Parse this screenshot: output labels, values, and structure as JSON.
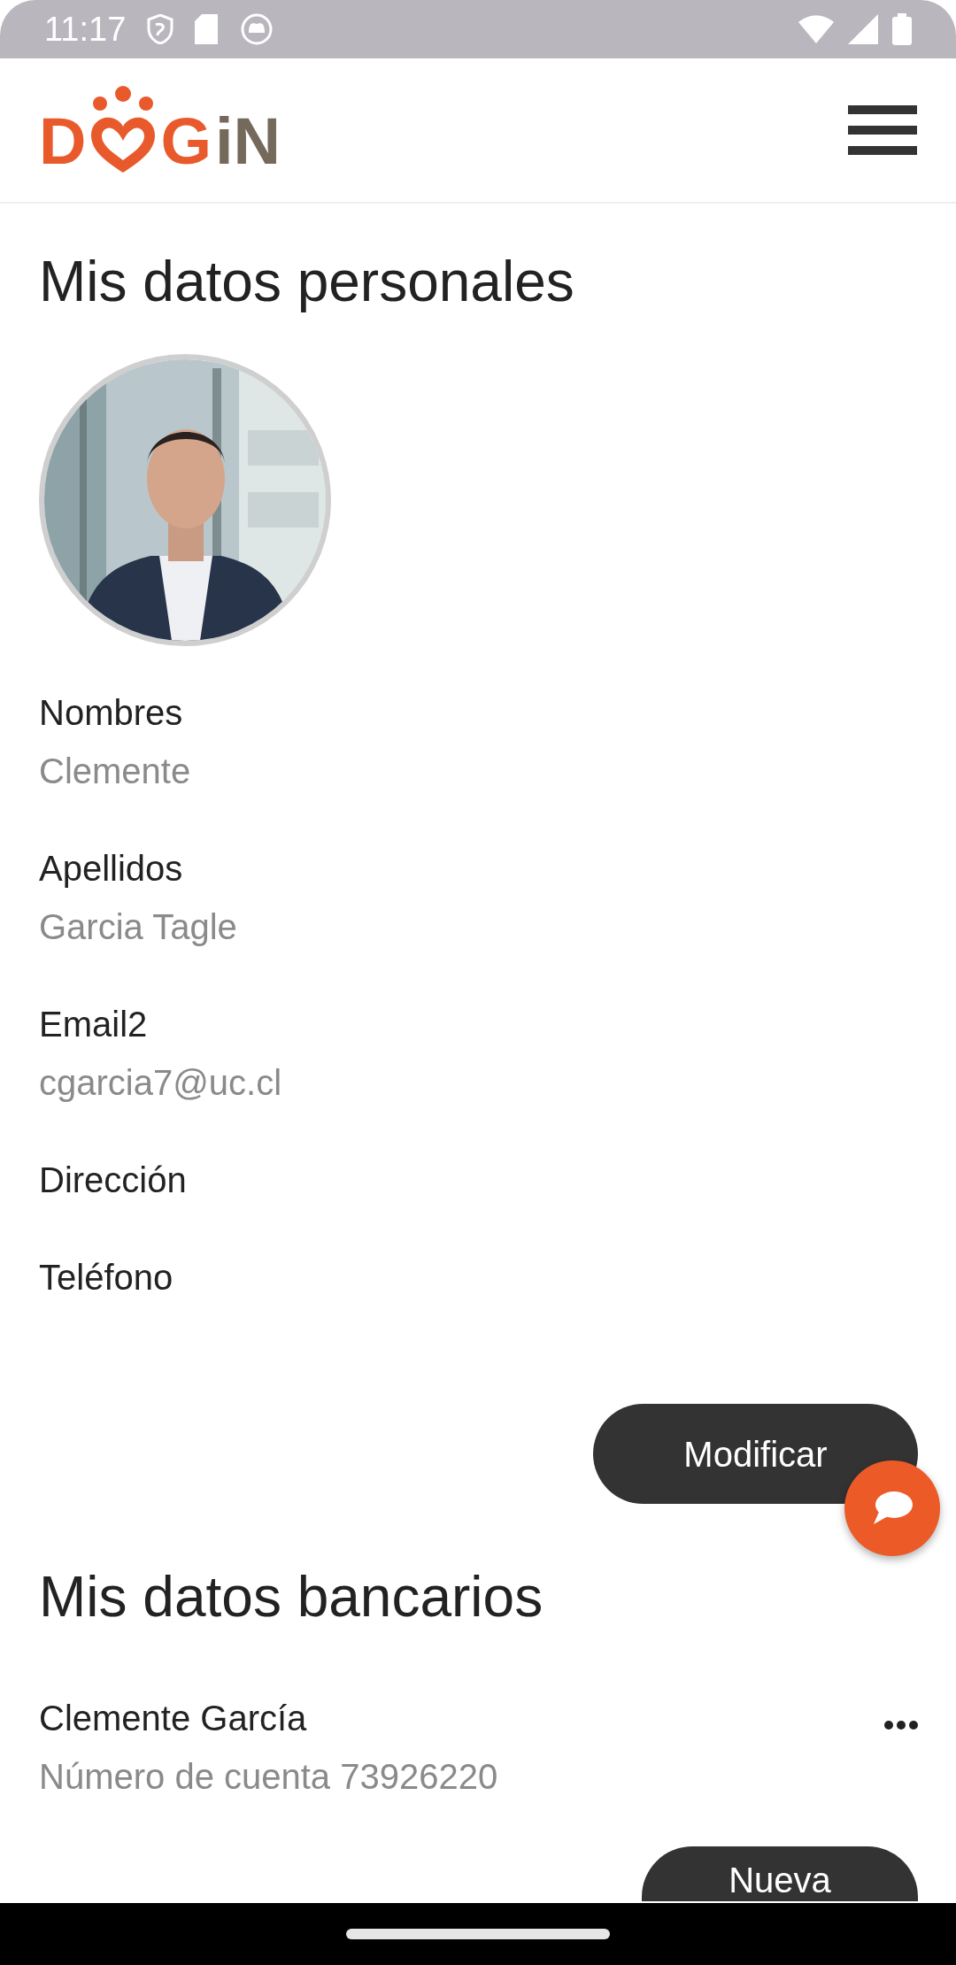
{
  "status_bar": {
    "time": "11:17"
  },
  "header": {
    "logo": {
      "orange_parts": [
        "D",
        "G"
      ],
      "brown_part": "iN"
    }
  },
  "profile": {
    "title": "Mis datos personales",
    "fields": [
      {
        "label": "Nombres",
        "value": "Clemente"
      },
      {
        "label": "Apellidos",
        "value": "Garcia Tagle"
      },
      {
        "label": "Email2",
        "value": "cgarcia7@uc.cl"
      },
      {
        "label": "Dirección"
      },
      {
        "label": "Teléfono"
      }
    ],
    "button": "Modificar"
  },
  "bank": {
    "title": "Mis datos bancarios",
    "accounts": [
      {
        "name": "Clemente García",
        "detail": "Número de cuenta 73926220"
      }
    ],
    "button": "Nueva"
  }
}
